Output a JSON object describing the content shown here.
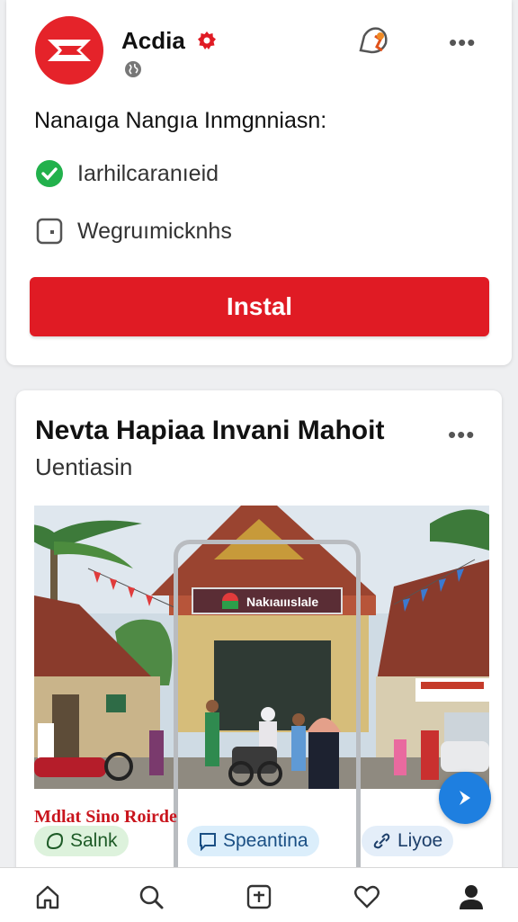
{
  "ad": {
    "brand_name": "Acdia",
    "headline": "Nanaıga Nangıa Inmgnniasn:",
    "features": [
      {
        "icon": "check-circle-icon",
        "label": "Iarhilcaranıeid"
      },
      {
        "icon": "square-icon",
        "label": "Wegruımicknhs"
      }
    ],
    "install_label": "Instal"
  },
  "post": {
    "title": "Nevta Hapiaa Invani Mahoit",
    "subtitle": "Uentiasin",
    "sign_text": "Nakıaıııslale",
    "promo_label": "Mdlat Sino Roirde",
    "chips": [
      {
        "icon": "leaf-icon",
        "label": "Salnk"
      },
      {
        "icon": "message-icon",
        "label": "Speantina"
      },
      {
        "icon": "link-icon",
        "label": "Liyoe"
      }
    ]
  },
  "colors": {
    "brand_red": "#e01b24",
    "accent_blue": "#1e7fe0",
    "check_green": "#22b14c"
  },
  "tabbar": {
    "items": [
      "home-icon",
      "search-icon",
      "add-post-icon",
      "heart-icon",
      "profile-icon"
    ]
  }
}
